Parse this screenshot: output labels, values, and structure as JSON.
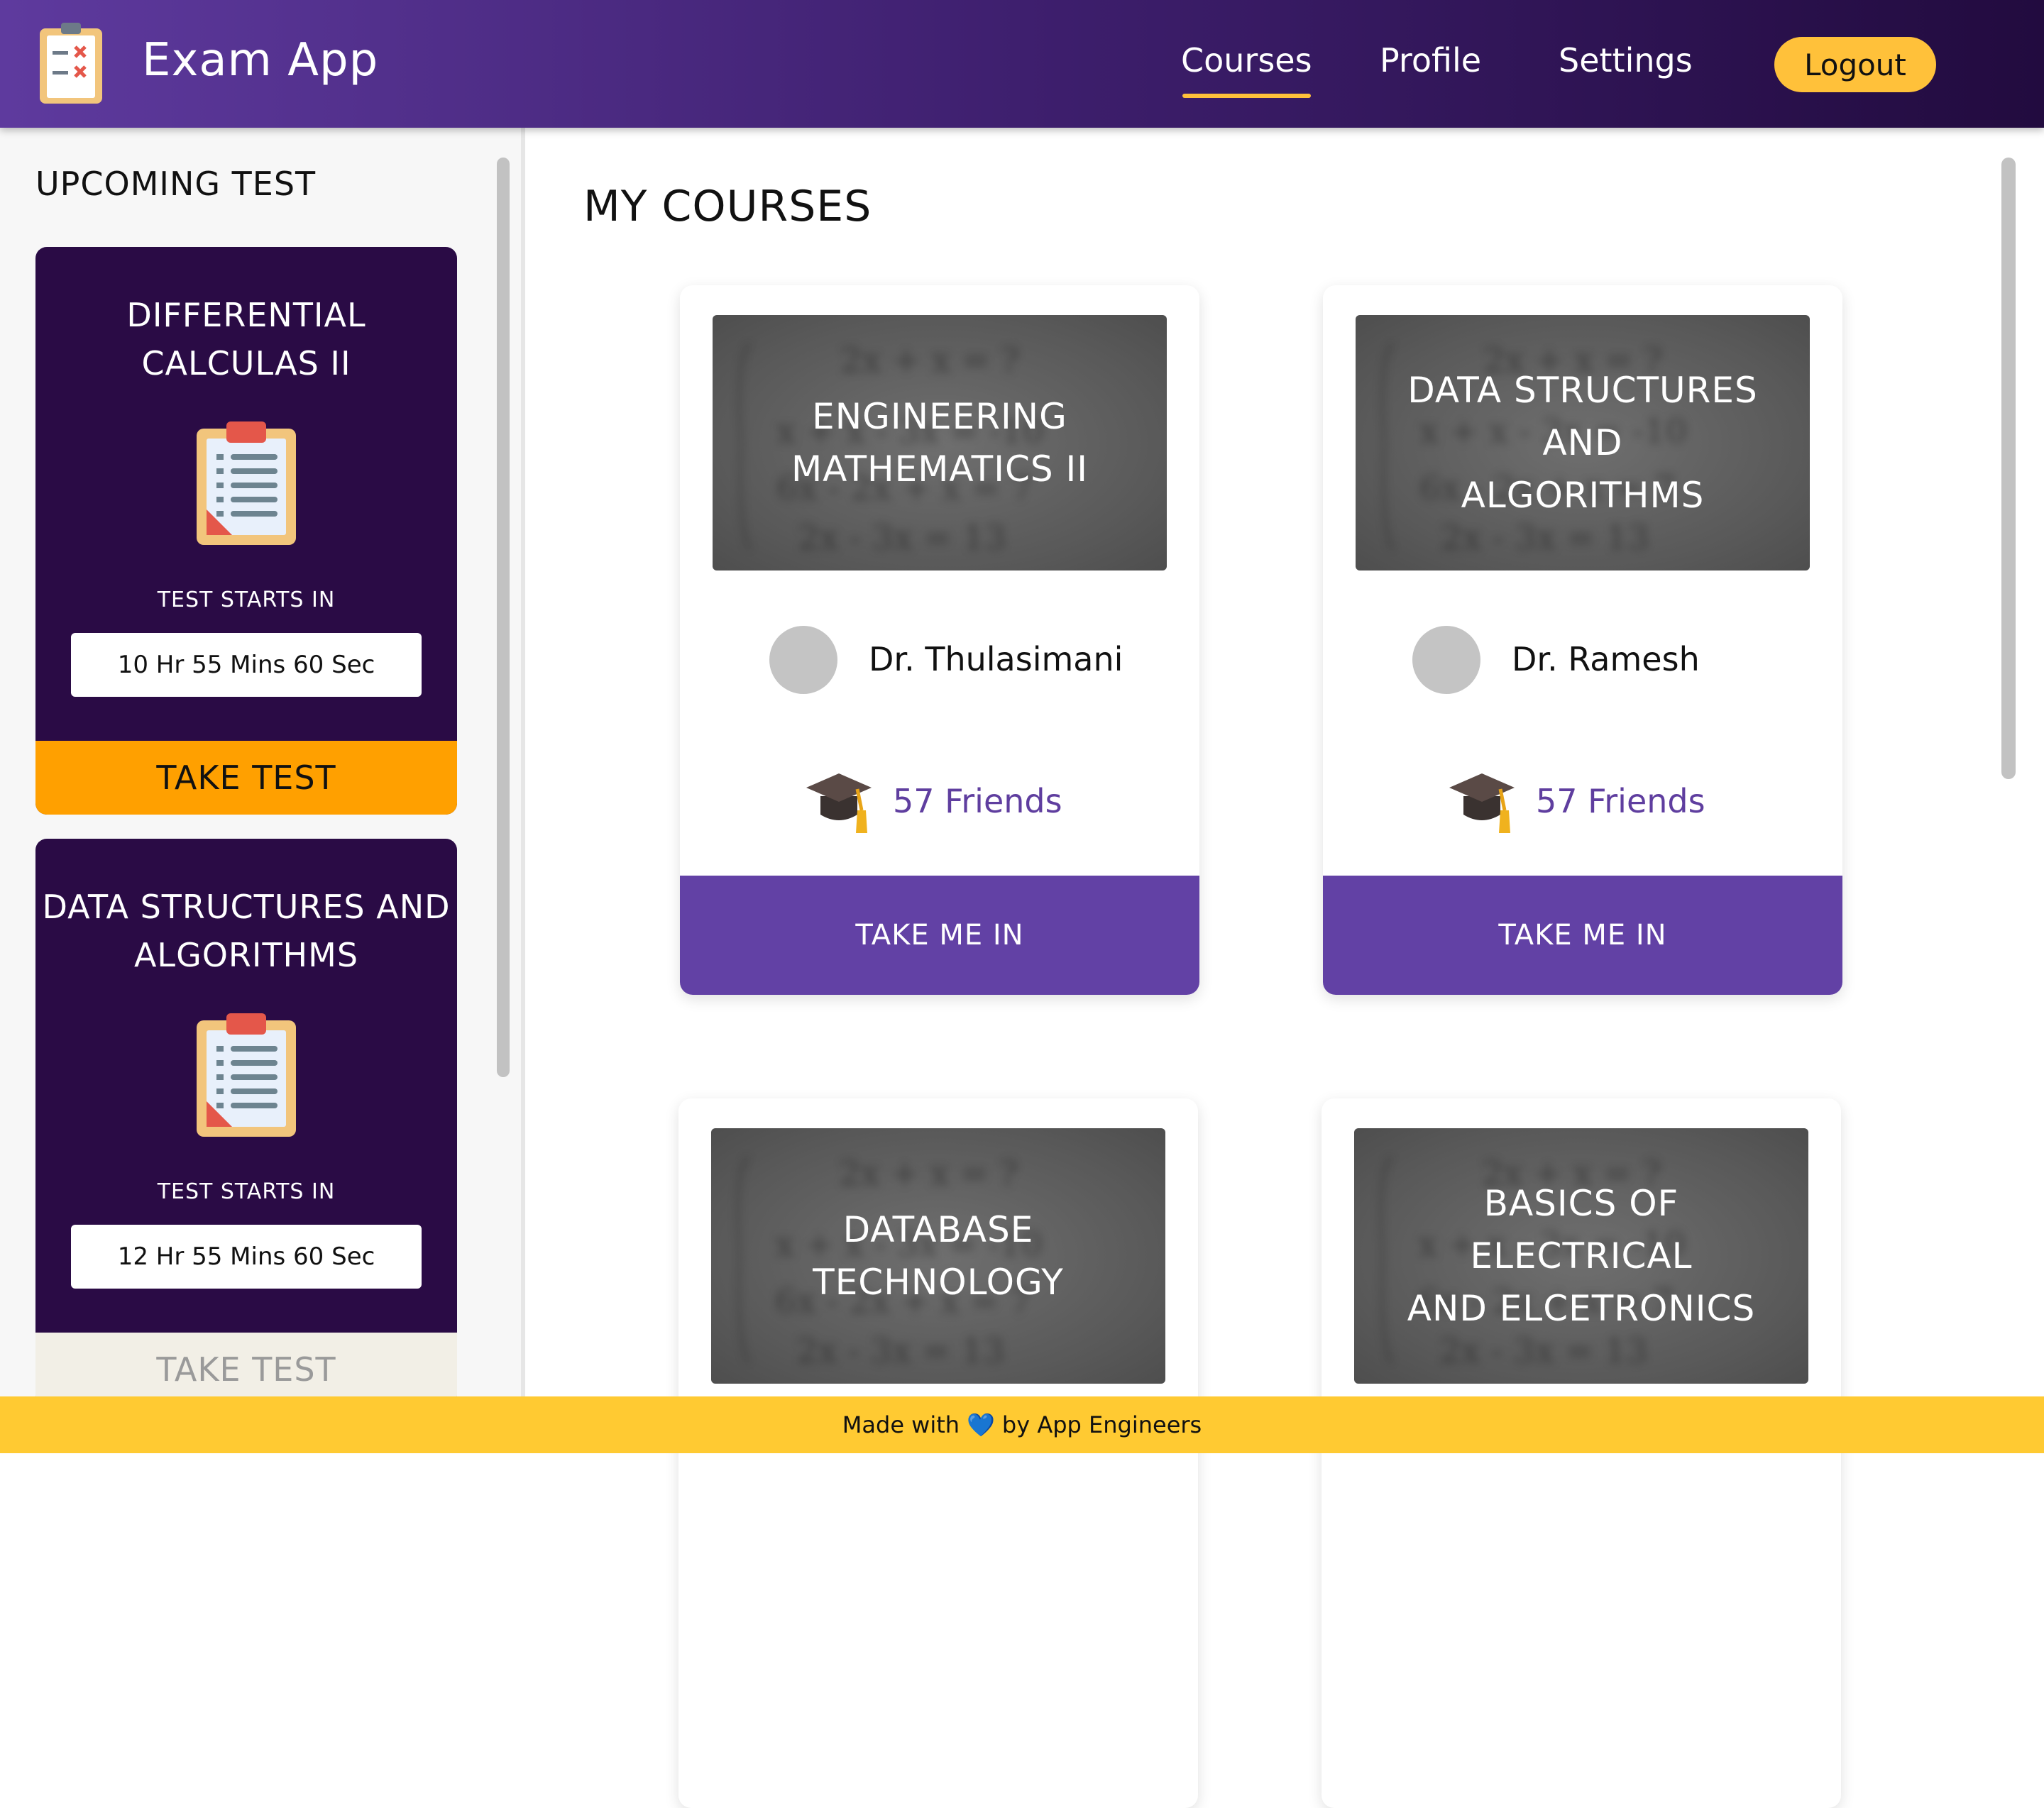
{
  "header": {
    "app_title": "Exam App",
    "nav": [
      "Courses",
      "Profile",
      "Settings"
    ],
    "active_nav": "Courses",
    "logout_label": "Logout",
    "logo_icon": "clipboard-checklist-icon"
  },
  "sidebar": {
    "title": "UPCOMING TEST",
    "tests": [
      {
        "name_line1": "DIFFERENTIAL",
        "name_line2": "CALCULAS II",
        "starts_label": "TEST STARTS IN",
        "countdown": "10 Hr 55 Mins 60 Sec",
        "button_label": "TAKE TEST",
        "enabled": true
      },
      {
        "name_line1": "DATA STRUCTURES AND",
        "name_line2": "ALGORITHMS",
        "starts_label": "TEST STARTS IN",
        "countdown": "12 Hr 55 Mins 60 Sec",
        "button_label": "TAKE TEST",
        "enabled": false
      }
    ]
  },
  "main": {
    "title": "MY COURSES",
    "courses": [
      {
        "name_line1": "ENGINEERING",
        "name_line2": "MATHEMATICS II",
        "teacher": "Dr. Thulasimani",
        "friends": "57 Friends",
        "button_label": "TAKE ME IN"
      },
      {
        "name_line1": "DATA STRUCTURES AND",
        "name_line2": "ALGORITHMS",
        "teacher": "Dr. Ramesh",
        "friends": "57 Friends",
        "button_label": "TAKE ME IN"
      },
      {
        "name_line1": "DATABASE TECHNOLOGY",
        "name_line2": ""
      },
      {
        "name_line1": "BASICS OF ELECTRICAL",
        "name_line2": "AND ELCETRONICS"
      }
    ]
  },
  "footer": {
    "prefix": "Made with",
    "heart": "💙",
    "suffix": "by App Engineers"
  },
  "colors": {
    "header_start": "#5e3a9e",
    "header_end": "#220b3f",
    "accent_yellow": "#ffc13a",
    "test_card_bg": "#2a0b45",
    "take_test_active": "#ffa000",
    "take_test_disabled": "#f2efe6",
    "course_button": "#6241a5",
    "footer_bg": "#ffca32"
  }
}
